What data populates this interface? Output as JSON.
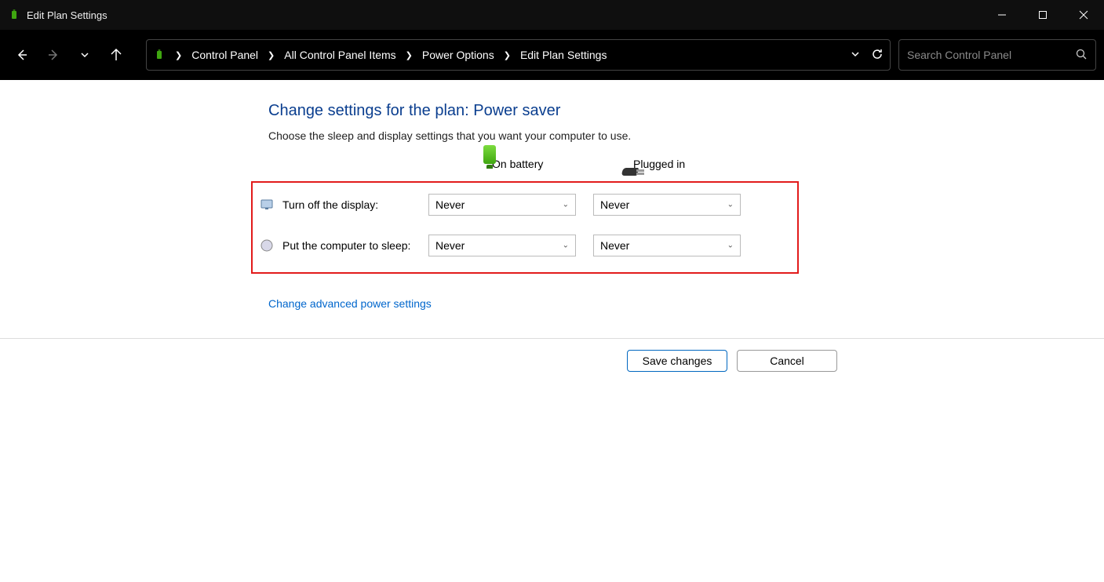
{
  "window": {
    "title": "Edit Plan Settings"
  },
  "breadcrumb": {
    "items": [
      "Control Panel",
      "All Control Panel Items",
      "Power Options",
      "Edit Plan Settings"
    ]
  },
  "search": {
    "placeholder": "Search Control Panel"
  },
  "page": {
    "heading": "Change settings for the plan: Power saver",
    "sub": "Choose the sleep and display settings that you want your computer to use.",
    "columns": {
      "battery": "On battery",
      "plugged": "Plugged in"
    },
    "rows": [
      {
        "label": "Turn off the display:",
        "battery_value": "Never",
        "plugged_value": "Never"
      },
      {
        "label": "Put the computer to sleep:",
        "battery_value": "Never",
        "plugged_value": "Never"
      }
    ],
    "advanced_link": "Change advanced power settings"
  },
  "footer": {
    "save": "Save changes",
    "cancel": "Cancel"
  }
}
